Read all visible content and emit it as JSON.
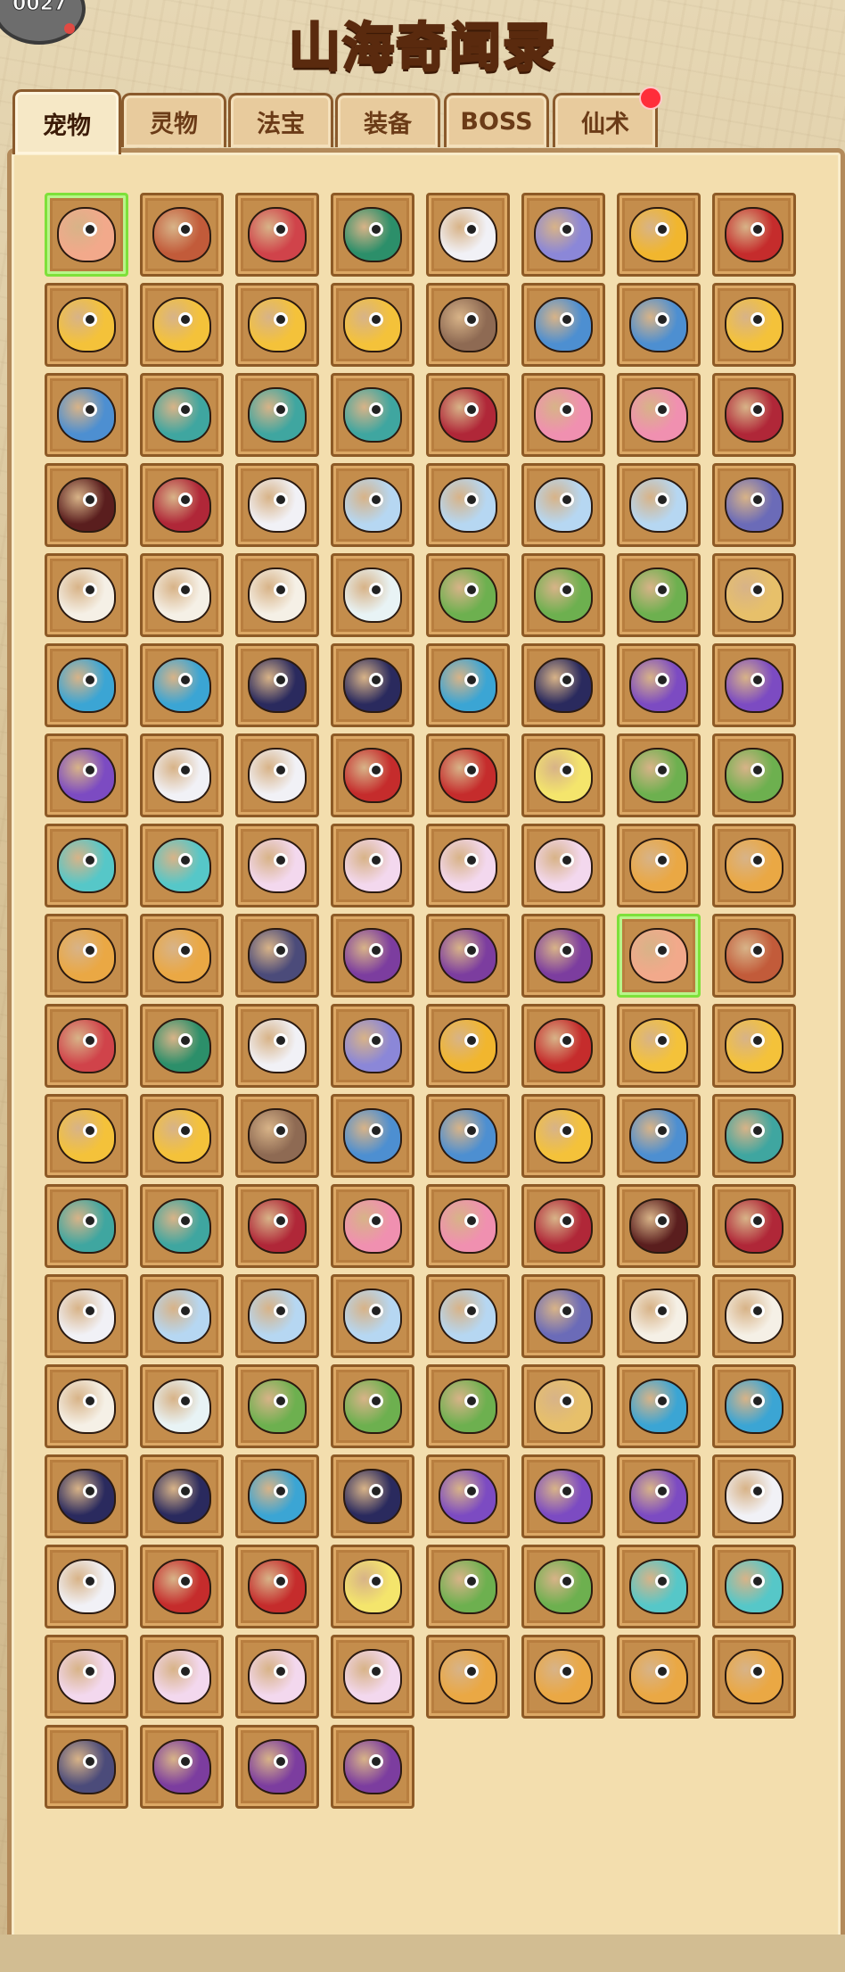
{
  "header": {
    "title": "山海奇闻录",
    "avatar_number": "0027"
  },
  "tabs": [
    {
      "label": "宠物",
      "active": true
    },
    {
      "label": "灵物",
      "active": false
    },
    {
      "label": "法宝",
      "active": false
    },
    {
      "label": "装备",
      "active": false
    },
    {
      "label": "BOSS",
      "active": false
    },
    {
      "label": "仙术",
      "active": false,
      "badge": true
    }
  ],
  "colors": {
    "pet_palette": [
      "#f2a98b",
      "#c25b3a",
      "#d0434a",
      "#2c8f6a",
      "#f1f1f6",
      "#8b87d8",
      "#f1b62e",
      "#c52c2c",
      "#f4c23a",
      "#4d8fd1",
      "#3fa6a0",
      "#8e6a53",
      "#f090b0",
      "#b02738",
      "#5a1e1e",
      "#b6d7f2",
      "#6b6bb8",
      "#f5f0e6",
      "#6db04f",
      "#e7c06a",
      "#3ba5d4",
      "#2a2a5e",
      "#7c4bc2",
      "#e8f3f5",
      "#f4e56c",
      "#56c7c8",
      "#f3d8ee",
      "#eaa844",
      "#4b4b7a",
      "#7c3d9f"
    ]
  },
  "pets": [
    {
      "icon": "pet-monkey-icon",
      "c": 0,
      "sel": true
    },
    {
      "icon": "pet-monkey-icon",
      "c": 1
    },
    {
      "icon": "pet-monkey-icon",
      "c": 2
    },
    {
      "icon": "pet-monkey-icon",
      "c": 3
    },
    {
      "icon": "pet-ghost-icon",
      "c": 4
    },
    {
      "icon": "pet-unicorn-icon",
      "c": 5
    },
    {
      "icon": "pet-helmet-icon",
      "c": 6
    },
    {
      "icon": "pet-warrior-icon",
      "c": 7
    },
    {
      "icon": "pet-fish-icon",
      "c": 8
    },
    {
      "icon": "pet-fish-icon",
      "c": 8
    },
    {
      "icon": "pet-fish-icon",
      "c": 8
    },
    {
      "icon": "pet-fish-icon",
      "c": 8
    },
    {
      "icon": "pet-beast-icon",
      "c": 11
    },
    {
      "icon": "pet-fish-icon",
      "c": 9
    },
    {
      "icon": "pet-fish-icon",
      "c": 9
    },
    {
      "icon": "pet-fish-icon",
      "c": 8
    },
    {
      "icon": "pet-dragon-icon",
      "c": 9
    },
    {
      "icon": "pet-dragon-icon",
      "c": 10
    },
    {
      "icon": "pet-dragon-icon",
      "c": 10
    },
    {
      "icon": "pet-dragon-icon",
      "c": 10
    },
    {
      "icon": "pet-dragon-icon",
      "c": 13
    },
    {
      "icon": "pet-bird-icon",
      "c": 12
    },
    {
      "icon": "pet-bird-icon",
      "c": 12
    },
    {
      "icon": "pet-bird-icon",
      "c": 13
    },
    {
      "icon": "pet-bird-icon",
      "c": 14
    },
    {
      "icon": "pet-dragon-icon",
      "c": 13
    },
    {
      "icon": "pet-dragon-icon",
      "c": 4
    },
    {
      "icon": "pet-sheep-icon",
      "c": 15
    },
    {
      "icon": "pet-sheep-icon",
      "c": 15
    },
    {
      "icon": "pet-sheep-icon",
      "c": 15
    },
    {
      "icon": "pet-sheep-icon",
      "c": 15
    },
    {
      "icon": "pet-robot-icon",
      "c": 16
    },
    {
      "icon": "pet-rabbit-icon",
      "c": 17
    },
    {
      "icon": "pet-rabbit-icon",
      "c": 17
    },
    {
      "icon": "pet-rabbit-icon",
      "c": 17
    },
    {
      "icon": "pet-rabbit-icon",
      "c": 23
    },
    {
      "icon": "pet-bird-icon",
      "c": 18
    },
    {
      "icon": "pet-bird-icon",
      "c": 18
    },
    {
      "icon": "pet-bird-icon",
      "c": 18
    },
    {
      "icon": "pet-bird-icon",
      "c": 19
    },
    {
      "icon": "pet-blob-icon",
      "c": 20
    },
    {
      "icon": "pet-unicorn-icon",
      "c": 20
    },
    {
      "icon": "pet-horse-icon",
      "c": 21
    },
    {
      "icon": "pet-horse-icon",
      "c": 21
    },
    {
      "icon": "pet-blob-icon",
      "c": 20
    },
    {
      "icon": "pet-blob-icon",
      "c": 21
    },
    {
      "icon": "pet-horse-icon",
      "c": 22
    },
    {
      "icon": "pet-horse-icon",
      "c": 22
    },
    {
      "icon": "pet-horse-icon",
      "c": 22
    },
    {
      "icon": "pet-beast-icon",
      "c": 4
    },
    {
      "icon": "pet-beast-icon",
      "c": 4
    },
    {
      "icon": "pet-beast-icon",
      "c": 7
    },
    {
      "icon": "pet-beast-icon",
      "c": 7
    },
    {
      "icon": "pet-chick-icon",
      "c": 24
    },
    {
      "icon": "pet-bird-icon",
      "c": 18
    },
    {
      "icon": "pet-bird-icon",
      "c": 18
    },
    {
      "icon": "pet-mermaid-icon",
      "c": 25
    },
    {
      "icon": "pet-mermaid-icon",
      "c": 25
    },
    {
      "icon": "pet-cat-icon",
      "c": 26
    },
    {
      "icon": "pet-cat-icon",
      "c": 26
    },
    {
      "icon": "pet-cat-icon",
      "c": 26
    },
    {
      "icon": "pet-cat-icon",
      "c": 26
    },
    {
      "icon": "pet-fox-icon",
      "c": 27
    },
    {
      "icon": "pet-fox-icon",
      "c": 27
    },
    {
      "icon": "pet-fox-icon",
      "c": 27
    },
    {
      "icon": "pet-fox-icon",
      "c": 27
    },
    {
      "icon": "pet-boar-icon",
      "c": 28
    },
    {
      "icon": "pet-boar-icon",
      "c": 29
    },
    {
      "icon": "pet-boar-icon",
      "c": 29
    },
    {
      "icon": "pet-boar-icon",
      "c": 29
    },
    {
      "icon": "pet-monkey-icon",
      "c": 0,
      "sel": true
    },
    {
      "icon": "pet-monkey-icon",
      "c": 1
    },
    {
      "icon": "pet-monkey-icon",
      "c": 2
    },
    {
      "icon": "pet-monkey-icon",
      "c": 3
    },
    {
      "icon": "pet-ghost-icon",
      "c": 4
    },
    {
      "icon": "pet-unicorn-icon",
      "c": 5
    },
    {
      "icon": "pet-helmet-icon",
      "c": 6
    },
    {
      "icon": "pet-warrior-icon",
      "c": 7
    },
    {
      "icon": "pet-fish-icon",
      "c": 8
    },
    {
      "icon": "pet-fish-icon",
      "c": 8
    },
    {
      "icon": "pet-fish-icon",
      "c": 8
    },
    {
      "icon": "pet-fish-icon",
      "c": 8
    },
    {
      "icon": "pet-beast-icon",
      "c": 11
    },
    {
      "icon": "pet-fish-icon",
      "c": 9
    },
    {
      "icon": "pet-fish-icon",
      "c": 9
    },
    {
      "icon": "pet-fish-icon",
      "c": 8
    },
    {
      "icon": "pet-dragon-icon",
      "c": 9
    },
    {
      "icon": "pet-dragon-icon",
      "c": 10
    },
    {
      "icon": "pet-dragon-icon",
      "c": 10
    },
    {
      "icon": "pet-dragon-icon",
      "c": 10
    },
    {
      "icon": "pet-dragon-icon",
      "c": 13
    },
    {
      "icon": "pet-bird-icon",
      "c": 12
    },
    {
      "icon": "pet-bird-icon",
      "c": 12
    },
    {
      "icon": "pet-bird-icon",
      "c": 13
    },
    {
      "icon": "pet-bird-icon",
      "c": 14
    },
    {
      "icon": "pet-dragon-icon",
      "c": 13
    },
    {
      "icon": "pet-dragon-icon",
      "c": 4
    },
    {
      "icon": "pet-sheep-icon",
      "c": 15
    },
    {
      "icon": "pet-sheep-icon",
      "c": 15
    },
    {
      "icon": "pet-sheep-icon",
      "c": 15
    },
    {
      "icon": "pet-sheep-icon",
      "c": 15
    },
    {
      "icon": "pet-robot-icon",
      "c": 16
    },
    {
      "icon": "pet-rabbit-icon",
      "c": 17
    },
    {
      "icon": "pet-rabbit-icon",
      "c": 17
    },
    {
      "icon": "pet-rabbit-icon",
      "c": 17
    },
    {
      "icon": "pet-rabbit-icon",
      "c": 23
    },
    {
      "icon": "pet-bird-icon",
      "c": 18
    },
    {
      "icon": "pet-bird-icon",
      "c": 18
    },
    {
      "icon": "pet-bird-icon",
      "c": 18
    },
    {
      "icon": "pet-bird-icon",
      "c": 19
    },
    {
      "icon": "pet-blob-icon",
      "c": 20
    },
    {
      "icon": "pet-unicorn-icon",
      "c": 20
    },
    {
      "icon": "pet-horse-icon",
      "c": 21
    },
    {
      "icon": "pet-horse-icon",
      "c": 21
    },
    {
      "icon": "pet-blob-icon",
      "c": 20
    },
    {
      "icon": "pet-blob-icon",
      "c": 21
    },
    {
      "icon": "pet-horse-icon",
      "c": 22
    },
    {
      "icon": "pet-horse-icon",
      "c": 22
    },
    {
      "icon": "pet-horse-icon",
      "c": 22
    },
    {
      "icon": "pet-beast-icon",
      "c": 4
    },
    {
      "icon": "pet-beast-icon",
      "c": 4
    },
    {
      "icon": "pet-beast-icon",
      "c": 7
    },
    {
      "icon": "pet-beast-icon",
      "c": 7
    },
    {
      "icon": "pet-chick-icon",
      "c": 24
    },
    {
      "icon": "pet-bird-icon",
      "c": 18
    },
    {
      "icon": "pet-bird-icon",
      "c": 18
    },
    {
      "icon": "pet-mermaid-icon",
      "c": 25
    },
    {
      "icon": "pet-mermaid-icon",
      "c": 25
    },
    {
      "icon": "pet-cat-icon",
      "c": 26
    },
    {
      "icon": "pet-cat-icon",
      "c": 26
    },
    {
      "icon": "pet-cat-icon",
      "c": 26
    },
    {
      "icon": "pet-cat-icon",
      "c": 26
    },
    {
      "icon": "pet-fox-icon",
      "c": 27
    },
    {
      "icon": "pet-fox-icon",
      "c": 27
    },
    {
      "icon": "pet-fox-icon",
      "c": 27
    },
    {
      "icon": "pet-fox-icon",
      "c": 27
    },
    {
      "icon": "pet-boar-icon",
      "c": 28
    },
    {
      "icon": "pet-boar-icon",
      "c": 29
    },
    {
      "icon": "pet-boar-icon",
      "c": 29
    },
    {
      "icon": "pet-boar-icon",
      "c": 29
    }
  ]
}
